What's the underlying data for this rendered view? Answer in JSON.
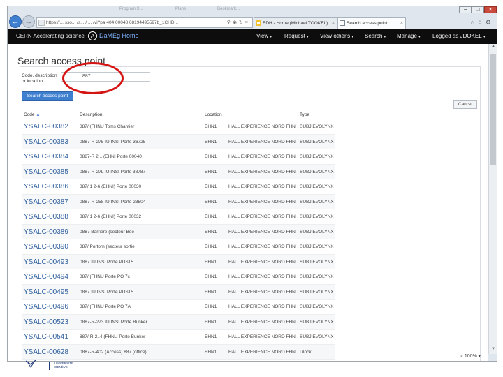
{
  "browser": {
    "address_url": "https://... sso... /s... / ... /vi?pa 404 00048 68194495597b_1CHD...",
    "tabs": [
      {
        "label": "EDH - Home (Michael TOOKEL)"
      },
      {
        "label": "Search access point"
      }
    ],
    "ghost_tabs": [
      "Program X...",
      "Plans",
      "Bookmark..."
    ],
    "window_buttons": {
      "minimize": "−",
      "maximize": "□",
      "close": "✕"
    }
  },
  "app_header": {
    "org": "CERN Accelerating science",
    "logo_letter": "A",
    "app_name": "DaMEg Home",
    "menus": [
      {
        "label": "View"
      },
      {
        "label": "Request"
      },
      {
        "label": "View other's"
      },
      {
        "label": "Search"
      },
      {
        "label": "Manage"
      },
      {
        "label": "Logged as JDOKEL"
      }
    ],
    "caret": "▾"
  },
  "page": {
    "title": "Search access point",
    "search_label": "Code, description or location",
    "search_value": "887",
    "search_button": "Search access point",
    "cancel_button": "Cancel"
  },
  "table": {
    "headers": {
      "code": "Code",
      "description": "Description",
      "location": "Location",
      "type": "Type"
    },
    "sort_indicator": "▲",
    "rows": [
      {
        "code": "YSALC-00382",
        "description": "887/ (FHNU Toms Chantier",
        "loc1": "EHN1",
        "loc2": "HALL EXPERIENCE NORD FHN1",
        "type": "SUBJ EVOLYNX"
      },
      {
        "code": "YSALC-00383",
        "description": "0887-R-275 IU INSI Porte 36725",
        "loc1": "EHN1",
        "loc2": "HALL EXPERIENCE NORD FHN1",
        "type": "SUBJ EVOLYNX"
      },
      {
        "code": "YSALC-00384",
        "description": "0887-R 2... (EHNI Porte 00040",
        "loc1": "EHN1",
        "loc2": "HALL EXPERIENCE NORD FHN1",
        "type": "SUBJ EVOLYNX"
      },
      {
        "code": "YSALC-00385",
        "description": "0887-R-27L IU INSI Porte 38787",
        "loc1": "EHN1",
        "loc2": "HALL EXPERIENCE NORD FHN1",
        "type": "SUBJ EVOLYNX"
      },
      {
        "code": "YSALC-00386",
        "description": "887/ 1 2-6 (EHNI) Porte 00030",
        "loc1": "EHN1",
        "loc2": "HALL EXPERIENCE NORD FHN1",
        "type": "SUBJ EVOLYNX"
      },
      {
        "code": "YSALC-00387",
        "description": "0887-R-258 IU INSI Porte 23504",
        "loc1": "EHN1",
        "loc2": "HALL EXPERIENCE NORD FHN1",
        "type": "SUBJ EVOLYNX"
      },
      {
        "code": "YSALC-00388",
        "description": "887/ 1 2-6 (EHNI) Porte 00032",
        "loc1": "EHN1",
        "loc2": "HALL EXPERIENCE NORD FHN1",
        "type": "SUBJ EVOLYNX"
      },
      {
        "code": "YSALC-00389",
        "description": "0887 Barriere (secteur Bee",
        "loc1": "EHN1",
        "loc2": "HALL EXPERIENCE NORD FHN1",
        "type": "SUBJ EVOLYNX"
      },
      {
        "code": "YSALC-00390",
        "description": "887/ Portorn (secteur sortie",
        "loc1": "EHN1",
        "loc2": "HALL EXPERIENCE NORD FHN1",
        "type": "SUBJ EVOLYNX"
      },
      {
        "code": "YSALC-00493",
        "description": "0887 IU INSI Porte PUS15",
        "loc1": "EHN1",
        "loc2": "HALL EXPERIENCE NORD FHN1",
        "type": "SUBJ EVOLYNX"
      },
      {
        "code": "YSALC-00494",
        "description": "887/ (FHNU Porte PO 7c",
        "loc1": "EHN1",
        "loc2": "HALL EXPERIENCE NORD FHN1",
        "type": "SUBJ EVOLYNX"
      },
      {
        "code": "YSALC-00495",
        "description": "0887 IU INSI Porte PUS15",
        "loc1": "EHN1",
        "loc2": "HALL EXPERIENCE NORD FHN1",
        "type": "SUBJ EVOLYNX"
      },
      {
        "code": "YSALC-00496",
        "description": "887/ (FHNU Porte PO 7A",
        "loc1": "EHN1",
        "loc2": "HALL EXPERIENCE NORD FHN1",
        "type": "SUBJ EVOLYNX"
      },
      {
        "code": "YSALC-00523",
        "description": "0887-R-273 IU INSI Porte Bunker",
        "loc1": "EHN1",
        "loc2": "HALL EXPERIENCE NORD FHN1",
        "type": "SUBJ EVOLYNX"
      },
      {
        "code": "YSALC-00541",
        "description": "887/-R-2..4 (FHNU Porte Bunker",
        "loc1": "EHN1",
        "loc2": "HALL EXPERIENCE NORD FHN1",
        "type": "SUBJ EVOLYNX"
      },
      {
        "code": "YSALC-00628",
        "description": "0887-R-402 (Access) 887 (office)",
        "loc1": "EHN1",
        "loc2": "HALL EXPERIENCE NORD FHN1",
        "type": "Lilock"
      }
    ]
  },
  "status_bar": {
    "zoom": "100%",
    "caret": "▾"
  },
  "footer": {
    "text_line1": "UNIVERSITÉ",
    "text_line2": "GENÈVE"
  },
  "colors": {
    "accent": "#3f7fd0",
    "link": "#2f5f9e",
    "header_bg": "#0d0d0d",
    "annotation": "#d51414"
  },
  "icons": [
    "back-arrow-icon",
    "forward-arrow-icon",
    "page-favicon-icon",
    "search-icon",
    "lock-icon",
    "refresh-icon",
    "home-icon",
    "star-icon",
    "settings-icon",
    "close-icon",
    "sort-ascending-icon"
  ]
}
